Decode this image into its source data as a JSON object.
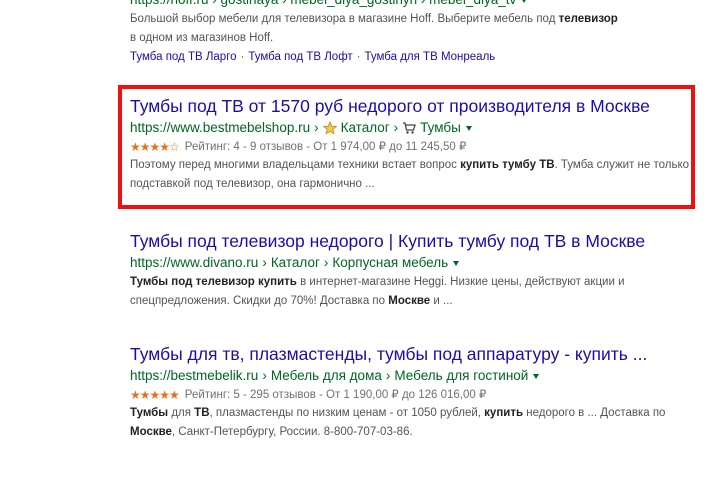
{
  "top_result": {
    "url": "https://hoff.ru › gostinaya › mebel_dlya_gostinyh › mebel_dlya_tv",
    "snippet_lines": [
      {
        "pre": "Большой выбор мебели для телевизора в магазине Hoff. Выберите мебель под ",
        "bold": "телевизор",
        "post": ""
      },
      {
        "pre": "в одном из магазинов Hoff.",
        "bold": "",
        "post": ""
      }
    ],
    "sitelinks": [
      "Тумба под ТВ Ларго",
      "Тумба под ТВ Лофт",
      "Тумба для ТВ Монреаль"
    ]
  },
  "results": [
    {
      "title": "Тумбы под ТВ от 1570 руб недорого от производителя в Москве",
      "url_base": "https://www.bestmebelshop.ru",
      "crumbs": [
        "Каталог",
        "Тумбы"
      ],
      "stars": "★★★★☆",
      "rating_text": "Рейтинг: 4 - 9 отзывов - От 1 974,00 ₽ до 11 245,50 ₽",
      "snippet_parts": [
        {
          "t": "Поэтому перед многими владельцами техники встает вопрос ",
          "b": false
        },
        {
          "t": "купить тумбу ТВ",
          "b": true
        },
        {
          "t": ". Тумба служит не только подставкой под телевизор, она гармонично ...",
          "b": false
        }
      ]
    },
    {
      "title": "Тумбы под телевизор недорого | Купить тумбу под ТВ в Москве",
      "url_base": "https://www.divano.ru",
      "crumbs": [
        "Каталог",
        "Корпусная мебель"
      ],
      "snippet_parts": [
        {
          "t": "Тумбы под телевизор купить",
          "b": true
        },
        {
          "t": " в интернет-магазине Heggi. Низкие цены, действуют акции и спецпредложения. Скидки до 70%! Доставка по ",
          "b": false
        },
        {
          "t": "Москве",
          "b": true
        },
        {
          "t": " и ...",
          "b": false
        }
      ]
    },
    {
      "title": "Тумбы для тв, плазмастенды, тумбы под аппаратуру - купить ...",
      "url_base": "https://bestmebelik.ru",
      "crumbs": [
        "Мебель для дома",
        "Мебель для гостиной"
      ],
      "stars": "★★★★★",
      "rating_text": "Рейтинг: 5 - 295 отзывов - От 1 190,00 ₽ до 126 016,00 ₽",
      "snippet_parts": [
        {
          "t": "Тумбы",
          "b": true
        },
        {
          "t": " для ",
          "b": false
        },
        {
          "t": "ТВ",
          "b": true
        },
        {
          "t": ", плазмастенды по низким ценам - от 1050 рублей, ",
          "b": false
        },
        {
          "t": "купить",
          "b": true
        },
        {
          "t": " недорого в ... Доставка по ",
          "b": false
        },
        {
          "t": "Москве",
          "b": true
        },
        {
          "t": ", Санкт-Петербургу, России. 8-800-707-03-86.",
          "b": false
        }
      ]
    }
  ]
}
